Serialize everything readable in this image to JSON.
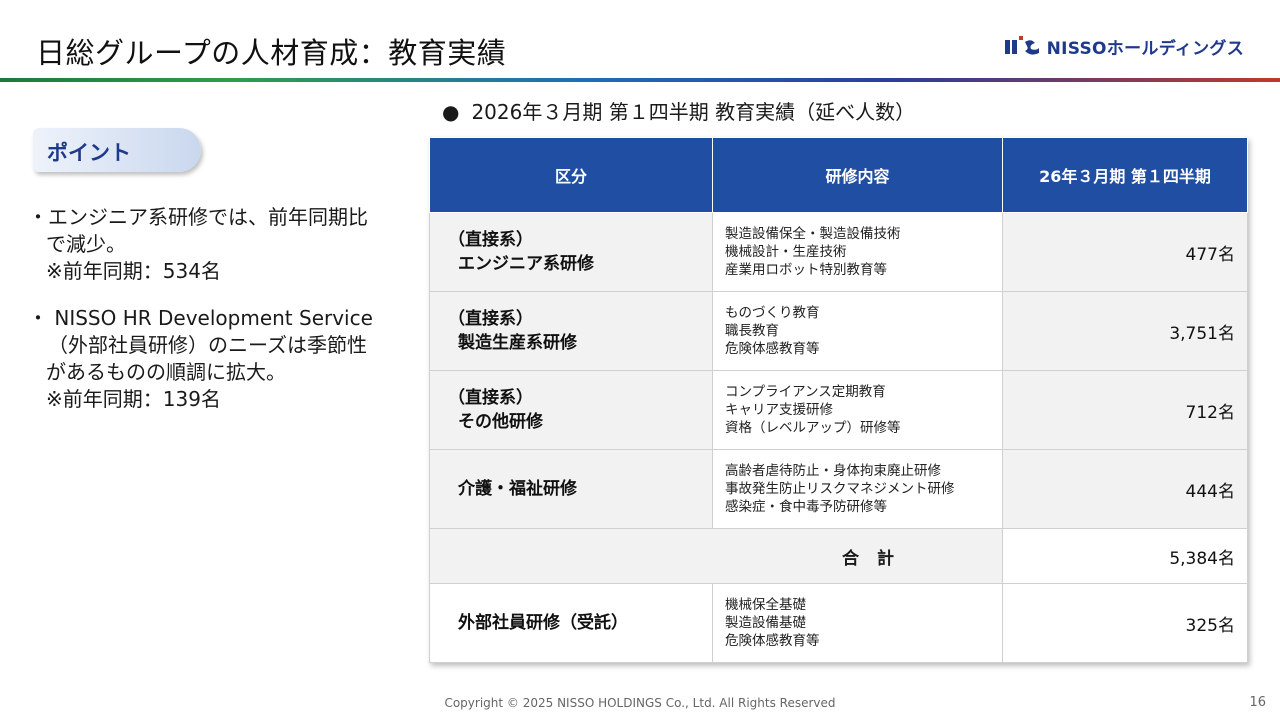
{
  "header": {
    "title": "日総グループの人材育成：教育実績",
    "logo_text": "NISSOホールディングス"
  },
  "point": {
    "label": "ポイント",
    "notes": [
      {
        "lines": [
          "・エンジニア系研修では、前年同期比",
          "で減少。",
          "※前年同期：534名"
        ]
      },
      {
        "lines": [
          "・ NISSO HR Development Service",
          "（外部社員研修）のニーズは季節性",
          "があるものの順調に拡大。",
          "※前年同期：139名"
        ]
      }
    ]
  },
  "section": {
    "heading": "2026年３月期 第１四半期 教育実績（延べ人数）"
  },
  "table": {
    "headers": [
      "区分",
      "研修内容",
      "26年３月期 第１四半期"
    ],
    "rows": [
      {
        "cat1": "（直接系）",
        "cat2": "エンジニア系研修",
        "desc": [
          "製造設備保全・製造設備技術",
          "機械設計・生産技術",
          "産業用ロボット特別教育等"
        ],
        "value": "477名"
      },
      {
        "cat1": "（直接系）",
        "cat2": "製造生産系研修",
        "desc": [
          "ものづくり教育",
          "職長教育",
          "危険体感教育等"
        ],
        "value": "3,751名"
      },
      {
        "cat1": "（直接系）",
        "cat2": "その他研修",
        "desc": [
          "コンプライアンス定期教育",
          "キャリア支援研修",
          "資格（レベルアップ）研修等"
        ],
        "value": "712名"
      },
      {
        "cat1": "",
        "cat2": "介護・福祉研修",
        "desc": [
          "高齢者虐待防止・身体拘束廃止研修",
          "事故発生防止リスクマネジメント研修",
          "感染症・食中毒予防研修等"
        ],
        "value": "444名"
      }
    ],
    "total": {
      "label": "合計",
      "value": "5,384名"
    },
    "extra": {
      "cat2": "外部社員研修（受託）",
      "desc": [
        "機械保全基礎",
        "製造設備基礎",
        "危険体感教育等"
      ],
      "value": "325名"
    }
  },
  "footer": {
    "copyright": "Copyright © 2025 NISSO HOLDINGS Co., Ltd. All Rights Reserved",
    "page": "16"
  }
}
